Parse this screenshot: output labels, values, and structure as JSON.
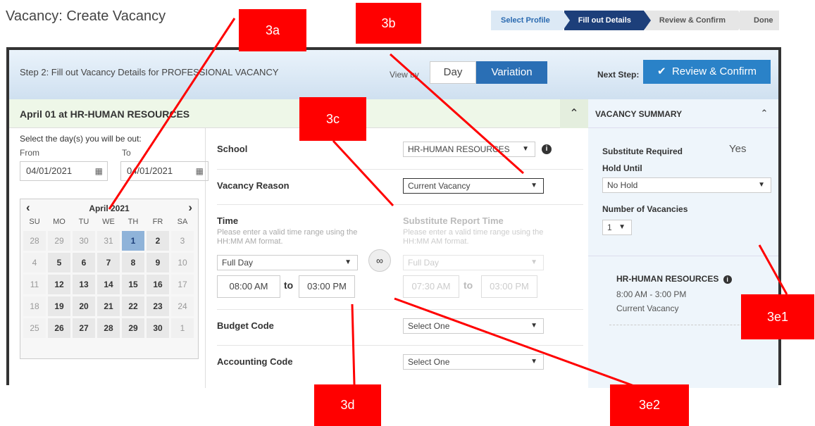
{
  "page": {
    "title": "Vacancy: Create Vacancy"
  },
  "wizard": {
    "steps": [
      "Select Profile",
      "Fill out Details",
      "Review & Confirm",
      "Done"
    ]
  },
  "topbar": {
    "step_text": "Step 2: Fill out Vacancy Details for PROFESSIONAL VACANCY",
    "view_by": "View by",
    "day": "Day",
    "variation": "Variation",
    "next_step": "Next Step:",
    "review_button": "Review & Confirm"
  },
  "day_header": {
    "title": "April 01 at HR-HUMAN RESOURCES"
  },
  "dates": {
    "select_label": "Select the day(s) you will be out:",
    "from_label": "From",
    "to_label": "To",
    "from_value": "04/01/2021",
    "to_value": "04/01/2021"
  },
  "calendar": {
    "month": "April 2021",
    "dow": [
      "SU",
      "MO",
      "TU",
      "WE",
      "TH",
      "FR",
      "SA"
    ],
    "weeks": [
      [
        "28",
        "29",
        "30",
        "31",
        "1",
        "2",
        "3"
      ],
      [
        "4",
        "5",
        "6",
        "7",
        "8",
        "9",
        "10"
      ],
      [
        "11",
        "12",
        "13",
        "14",
        "15",
        "16",
        "17"
      ],
      [
        "18",
        "19",
        "20",
        "21",
        "22",
        "23",
        "24"
      ],
      [
        "25",
        "26",
        "27",
        "28",
        "29",
        "30",
        "1"
      ]
    ],
    "selected": "1"
  },
  "form": {
    "school_label": "School",
    "school_value": "HR-HUMAN RESOURCES",
    "reason_label": "Vacancy Reason",
    "reason_value": "Current Vacancy",
    "time_label": "Time",
    "time_hint": "Please enter a valid time range using the HH:MM AM format.",
    "time_select": "Full Day",
    "time_start": "08:00 AM",
    "time_to": "to",
    "time_end": "03:00 PM",
    "sub_report_label": "Substitute Report Time",
    "sub_hint": "Please enter a valid time range using the HH:MM AM format.",
    "sub_select": "Full Day",
    "sub_start": "07:30 AM",
    "sub_end": "03:00 PM",
    "budget_label": "Budget Code",
    "budget_value": "Select One",
    "accounting_label": "Accounting Code",
    "accounting_value": "Select One"
  },
  "summary": {
    "title": "VACANCY SUMMARY",
    "sub_required_label": "Substitute Required",
    "sub_required_value": "Yes",
    "hold_label": "Hold Until",
    "hold_value": "No Hold",
    "num_label": "Number of Vacancies",
    "num_value": "1",
    "school": "HR-HUMAN RESOURCES",
    "time": "8:00 AM - 3:00 PM",
    "reason": "Current Vacancy"
  },
  "callouts": {
    "a": "3a",
    "b": "3b",
    "c": "3c",
    "d": "3d",
    "e1": "3e1",
    "e2": "3e2"
  },
  "icons": {
    "calendar": "calendar-icon",
    "info": "info-icon",
    "link": "link-icon",
    "check": "check-icon"
  },
  "colors": {
    "accent": "#1d3f7a",
    "primary_button": "#2a82c8",
    "callout": "#ff0000"
  }
}
